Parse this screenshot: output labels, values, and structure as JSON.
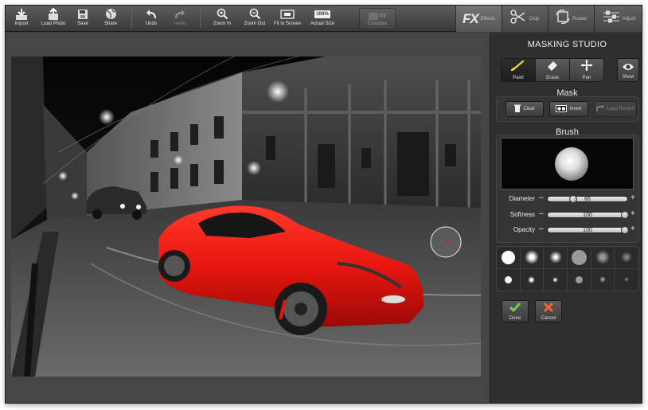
{
  "toolbar": {
    "import": "Import",
    "load_photo": "Load Photo",
    "save": "Save",
    "share": "Share",
    "undo": "Undo",
    "redo": "Redo",
    "zoom_in": "Zoom In",
    "zoom_out": "Zoom Out",
    "fit_to_screen": "Fit to Screen",
    "actual_size": "Actual Size",
    "actual_size_icon_text": "100%",
    "compare": "Compare",
    "compare_icon_text": "FX"
  },
  "modes": {
    "fx_logo": "FX",
    "effects": "Effects",
    "crop": "Crop",
    "rotate": "Rotate",
    "adjust": "Adjust"
  },
  "panel": {
    "title": "MASKING STUDIO",
    "tools": {
      "paint": "Paint",
      "erase": "Erase",
      "pan": "Pan",
      "show": "Show"
    },
    "mask": {
      "title": "Mask",
      "clear": "Clear",
      "invert": "Invert",
      "load_recent": "Load Recent"
    },
    "brush": {
      "title": "Brush",
      "diameter": {
        "label": "Diameter",
        "value": "66",
        "level": 0.32
      },
      "softness": {
        "label": "Softness",
        "value": "100",
        "level": 1.0
      },
      "opacity": {
        "label": "Opacity",
        "value": "100",
        "level": 1.0
      }
    },
    "actions": {
      "done": "Done",
      "cancel": "Cancel"
    }
  },
  "colors": {
    "accent_yellow": "#e8d23a",
    "done_green": "#6fd14a",
    "cancel_orange": "#f0662c",
    "car_red": "#e8150f"
  }
}
